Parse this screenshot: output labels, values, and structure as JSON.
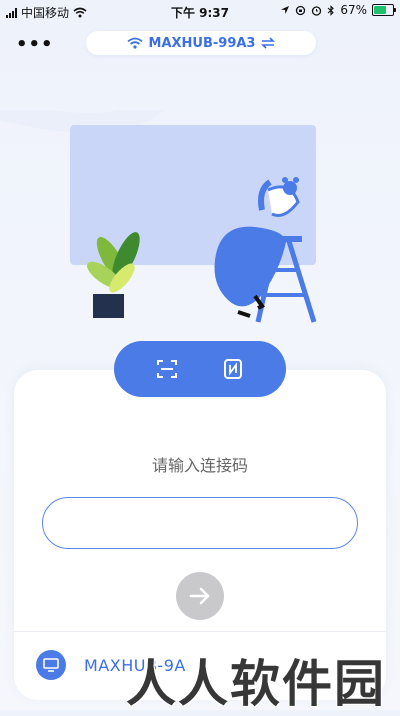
{
  "status_bar": {
    "carrier": "中国移动",
    "time": "下午 9:37",
    "battery_text": "67%",
    "battery_level": 0.67
  },
  "header": {
    "more_label": "•••",
    "device_name": "MAXHUB-99A3"
  },
  "prompt": "请输入连接码",
  "code_input": {
    "value": "",
    "placeholder": ""
  },
  "recent_device": {
    "label": "MAXHUB-9A"
  },
  "watermark": "人人软件园",
  "colors": {
    "accent": "#4a7be6",
    "disabled": "#c9c9cc",
    "text_link": "#3a6fe8"
  }
}
